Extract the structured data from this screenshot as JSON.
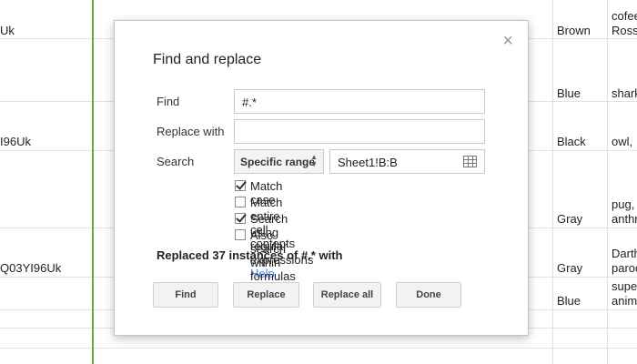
{
  "sheet": {
    "left_cells": [
      "Uk",
      "I96Uk",
      "Q03YI96Uk"
    ],
    "color_cells": [
      "Brown",
      "Blue",
      "Black",
      "Gray",
      "Gray",
      "Blue"
    ],
    "desc_cells": [
      "cofee\nRoss",
      "shark",
      "owl,",
      "pug,\nanthr",
      "Darth\nparod",
      "supe\nanim"
    ]
  },
  "dialog": {
    "title": "Find and replace",
    "close_icon": "×",
    "find_label": "Find",
    "find_value": "#.*",
    "replace_label": "Replace with",
    "replace_value": "",
    "search_label": "Search",
    "search_scope": "Specific range",
    "search_range": "Sheet1!B:B",
    "options": [
      {
        "label": "Match case",
        "checked": true
      },
      {
        "label": "Match entire cell contents",
        "checked": false
      },
      {
        "label": "Search using regular expressions",
        "checked": true
      },
      {
        "label": "Also search within formulas",
        "checked": false
      }
    ],
    "help_link": "Help",
    "status": "Replaced 37 instances of #.* with",
    "buttons": {
      "find": "Find",
      "replace": "Replace",
      "replace_all": "Replace all",
      "done": "Done"
    }
  }
}
